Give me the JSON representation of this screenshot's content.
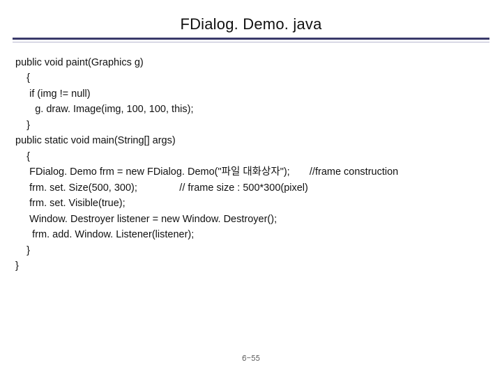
{
  "title": "FDialog. Demo. java",
  "code": "public void paint(Graphics g)\n    {\n     if (img != null)\n       g. draw. Image(img, 100, 100, this);\n    }\npublic static void main(String[] args)\n    {\n     FDialog. Demo frm = new FDialog. Demo(\"파일 대화상자\");       //frame construction\n     frm. set. Size(500, 300);               // frame size : 500*300(pixel)\n     frm. set. Visible(true);\n     Window. Destroyer listener = new Window. Destroyer();\n      frm. add. Window. Listener(listener);\n    }\n}",
  "page_number": "6-55"
}
